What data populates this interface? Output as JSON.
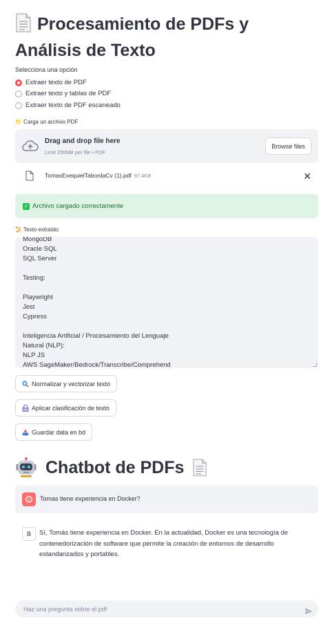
{
  "header": {
    "title": "Procesamiento de PDFs y Análisis de Texto",
    "icon": "page-facing-up-icon"
  },
  "options": {
    "label": "Selecciona una opción",
    "items": [
      {
        "label": "Extraer texto de PDF",
        "selected": true
      },
      {
        "label": "Extraer texto y tablas de PDF",
        "selected": false
      },
      {
        "label": "Extraer texto de PDF escaneado",
        "selected": false
      }
    ]
  },
  "uploader": {
    "label": "📁 Carga un archivo PDF",
    "drag_text": "Drag and drop file here",
    "limit_text": "Limit 200MB per file • PDF",
    "browse_label": "Browse files"
  },
  "file": {
    "name": "TomasExequielTabordaCv (1).pdf",
    "size": "97.4KB"
  },
  "success": {
    "message": "Archivo cargado correctamente"
  },
  "extracted": {
    "label": "📜 Texto extraído:",
    "text": "MongoDB\nOracle SQL\nSQL Server\n\nTesting:\n\nPlaywright\nJest\nCypress\n\nInteligencia Artificial / Procesamiento del Lenguaje\nNatural (NLP):\nNLP JS\nAWS SageMaker/Bedrock/Transcribe/Comprehend"
  },
  "actions": {
    "normalize_label": "Normalizar y vectorizar texto",
    "classify_label": "Aplicar clasificación de texto",
    "save_label": "Guardar data en bd"
  },
  "chatbot": {
    "title": "Chatbot de PDFs",
    "user_message": "Tomas tiene experiencia en Docker?",
    "bot_avatar": "B",
    "bot_message": "Sí, Tomás tiene experiencia en Docker. En la actualidad, Docker es una tecnología de contenedorización de software que permite la creación de entornos de desarrollo estandarizados y portables.",
    "input_placeholder": "Haz una pregunta sobre el pdf"
  },
  "colors": {
    "accent": "#ff4b4b",
    "success_bg": "#dff3e5",
    "success_text": "#177233",
    "panel_bg": "#f0f2f6"
  }
}
